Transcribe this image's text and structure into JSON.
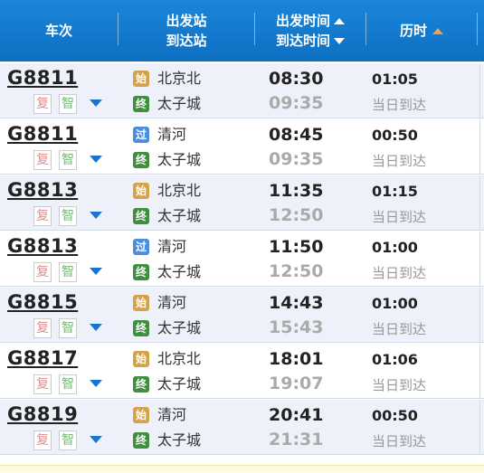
{
  "header": {
    "col_train": "车次",
    "col_station_dep": "出发站",
    "col_station_arr": "到达站",
    "col_time_dep": "出发时间",
    "col_time_arr": "到达时间",
    "col_duration": "历时"
  },
  "colors": {
    "header_bg": "#1a86d9",
    "row_alt": "#eef1f9",
    "icon_start": "#d4a24a",
    "icon_pass": "#4d8de0",
    "icon_end": "#3e8f3e",
    "sort_arrow": "#f0a050"
  },
  "rows": [
    {
      "train": "G8811",
      "fu": "复",
      "zhi": "智",
      "dep_icon": "始",
      "dep_icon_type": "start",
      "dep_station": "北京北",
      "arr_icon": "终",
      "arr_station": "太子城",
      "dep_time": "08:30",
      "arr_time": "09:35",
      "duration": "01:05",
      "arrival_day": "当日到达"
    },
    {
      "train": "G8811",
      "fu": "复",
      "zhi": "智",
      "dep_icon": "过",
      "dep_icon_type": "pass",
      "dep_station": "清河",
      "arr_icon": "终",
      "arr_station": "太子城",
      "dep_time": "08:45",
      "arr_time": "09:35",
      "duration": "00:50",
      "arrival_day": "当日到达"
    },
    {
      "train": "G8813",
      "fu": "复",
      "zhi": "智",
      "dep_icon": "始",
      "dep_icon_type": "start",
      "dep_station": "北京北",
      "arr_icon": "终",
      "arr_station": "太子城",
      "dep_time": "11:35",
      "arr_time": "12:50",
      "duration": "01:15",
      "arrival_day": "当日到达"
    },
    {
      "train": "G8813",
      "fu": "复",
      "zhi": "智",
      "dep_icon": "过",
      "dep_icon_type": "pass",
      "dep_station": "清河",
      "arr_icon": "终",
      "arr_station": "太子城",
      "dep_time": "11:50",
      "arr_time": "12:50",
      "duration": "01:00",
      "arrival_day": "当日到达"
    },
    {
      "train": "G8815",
      "fu": "复",
      "zhi": "智",
      "dep_icon": "始",
      "dep_icon_type": "start",
      "dep_station": "清河",
      "arr_icon": "终",
      "arr_station": "太子城",
      "dep_time": "14:43",
      "arr_time": "15:43",
      "duration": "01:00",
      "arrival_day": "当日到达"
    },
    {
      "train": "G8817",
      "fu": "复",
      "zhi": "智",
      "dep_icon": "始",
      "dep_icon_type": "start",
      "dep_station": "北京北",
      "arr_icon": "终",
      "arr_station": "太子城",
      "dep_time": "18:01",
      "arr_time": "19:07",
      "duration": "01:06",
      "arrival_day": "当日到达"
    },
    {
      "train": "G8819",
      "fu": "复",
      "zhi": "智",
      "dep_icon": "始",
      "dep_icon_type": "start",
      "dep_station": "清河",
      "arr_icon": "终",
      "arr_station": "太子城",
      "dep_time": "20:41",
      "arr_time": "21:31",
      "duration": "00:50",
      "arrival_day": "当日到达"
    }
  ]
}
